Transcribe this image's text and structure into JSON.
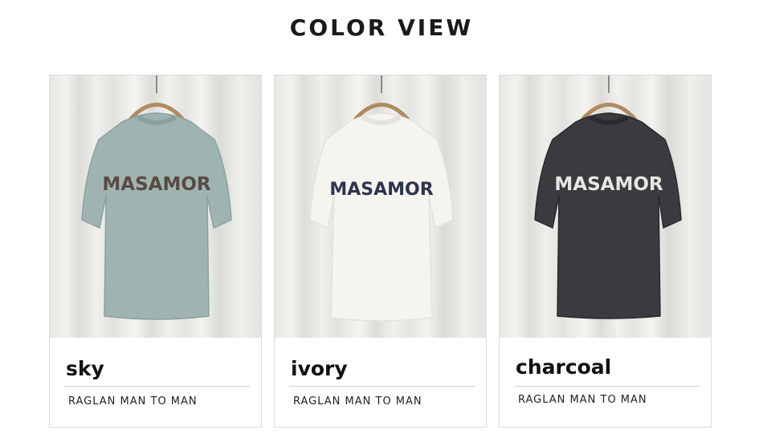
{
  "header": {
    "title": "COLOR VIEW"
  },
  "products": [
    {
      "color": "sky",
      "name": "RAGLAN MAN TO MAN",
      "print": "MASAMOR",
      "shirt_color": "#9fb4b1",
      "shirt_shade": "#8aa19e",
      "print_color": "#5a4a44"
    },
    {
      "color": "ivory",
      "name": "RAGLAN MAN TO MAN",
      "print": "MASAMOR",
      "shirt_color": "#f5f4ef",
      "shirt_shade": "#e3e2dc",
      "print_color": "#2f3450"
    },
    {
      "color": "charcoal",
      "name": "RAGLAN MAN TO MAN",
      "print": "MASAMOR",
      "shirt_color": "#3b3a3f",
      "shirt_shade": "#2b2a2f",
      "print_color": "#e8e6e2"
    }
  ]
}
